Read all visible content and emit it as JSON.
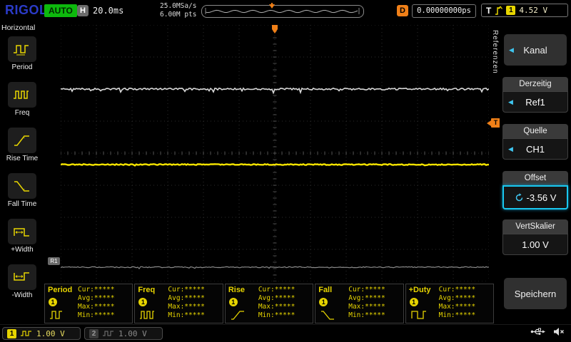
{
  "topbar": {
    "logo": "RIGOL",
    "run_state": "AUTO",
    "h_label": "H",
    "timebase": "20.0ms",
    "sample_rate": "25.0MSa/s",
    "memory_depth": "6.00M pts",
    "delay_label": "D",
    "delay_value": "0.00000000ps",
    "trigger_label": "T",
    "trigger_source": "1",
    "trigger_level": "4.52 V"
  },
  "sidebar": {
    "title": "Horizontal",
    "items": [
      {
        "label": "Period"
      },
      {
        "label": "Freq"
      },
      {
        "label": "Rise Time"
      },
      {
        "label": "Fall Time"
      },
      {
        "label": "+Width"
      },
      {
        "label": "-Width"
      }
    ]
  },
  "scope": {
    "ref_marker": "R1",
    "trigger_marker": "T"
  },
  "measurements": {
    "stat_labels": [
      "Cur:",
      "Avg:",
      "Max:",
      "Min:"
    ],
    "panels": [
      {
        "name": "Period",
        "channel": "1",
        "values": [
          "*****",
          "*****",
          "*****",
          "*****"
        ]
      },
      {
        "name": "Freq",
        "channel": "1",
        "values": [
          "*****",
          "*****",
          "*****",
          "*****"
        ]
      },
      {
        "name": "Rise",
        "channel": "1",
        "values": [
          "*****",
          "*****",
          "*****",
          "*****"
        ]
      },
      {
        "name": "Fall",
        "channel": "1",
        "values": [
          "*****",
          "*****",
          "*****",
          "*****"
        ]
      },
      {
        "name": "+Duty",
        "channel": "1",
        "values": [
          "*****",
          "*****",
          "*****",
          "*****"
        ]
      }
    ]
  },
  "menu": {
    "tab": "Referenzen",
    "channel_button": "Kanal",
    "sections": [
      {
        "header": "Derzeitig",
        "value": "Ref1"
      },
      {
        "header": "Quelle",
        "value": "CH1"
      },
      {
        "header": "Offset",
        "value": "-3.56 V"
      },
      {
        "header": "VertSkalier",
        "value": "1.00 V"
      }
    ],
    "save_button": "Speichern"
  },
  "statusbar": {
    "ch1": {
      "number": "1",
      "scale": "1.00 V"
    },
    "ch2": {
      "number": "2",
      "scale": "1.00 V"
    }
  },
  "colors": {
    "ch1_yellow": "#f0dc00",
    "trigger_orange": "#f08018",
    "menu_cyan": "#3fc6f0",
    "run_green": "#0db90d",
    "logo_blue": "#2b3bc8"
  }
}
